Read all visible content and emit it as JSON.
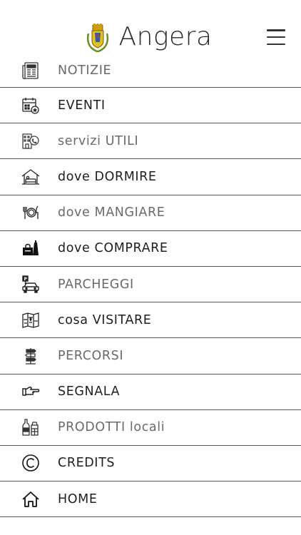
{
  "header": {
    "title": "Angera",
    "logo_icon": "angera-crest-icon",
    "menu_icon": "hamburger-menu-icon"
  },
  "colors": {
    "text_dark": "#1e1e1e",
    "text_dim": "#6a6a6a",
    "divider": "#555555",
    "background": "#ffffff"
  },
  "menu": {
    "items": [
      {
        "label": "NOTIZIE",
        "icon": "newspaper-icon"
      },
      {
        "label": "EVENTI",
        "icon": "calendar-icon"
      },
      {
        "label": "servizi UTILI",
        "icon": "building-phone-icon"
      },
      {
        "label": "dove DORMIRE",
        "icon": "bed-house-icon"
      },
      {
        "label": "dove MANGIARE",
        "icon": "fork-plate-knife-icon"
      },
      {
        "label": "dove COMPRARE",
        "icon": "shopping-icon"
      },
      {
        "label": "PARCHEGGI",
        "icon": "parking-car-icon"
      },
      {
        "label": "cosa VISITARE",
        "icon": "map-icon"
      },
      {
        "label": "PERCORSI",
        "icon": "signpost-icon"
      },
      {
        "label": "SEGNALA",
        "icon": "pointing-hand-icon"
      },
      {
        "label": "PRODOTTI locali",
        "icon": "bottles-icon"
      },
      {
        "label": "CREDITS",
        "icon": "copyright-icon"
      },
      {
        "label": "HOME",
        "icon": "home-icon"
      }
    ]
  }
}
